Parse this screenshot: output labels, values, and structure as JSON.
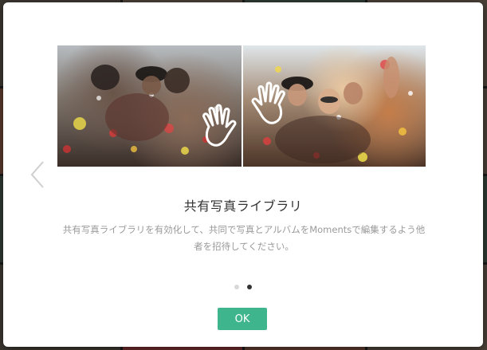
{
  "dialog": {
    "title": "共有写真ライブラリ",
    "description": "共有写真ライブラリを有効化して、共同で写真とアルバムをMomentsで編集するよう他者を招待してください。",
    "ok_label": "OK"
  },
  "pagination": {
    "total": 2,
    "active_index": 1
  },
  "icons": {
    "prev": "chevron-left-icon",
    "hand_left": "waving-hand-icon",
    "hand_right": "waving-hand-icon"
  },
  "colors": {
    "accent": "#3fb58e",
    "title": "#333333",
    "description": "#9a9a9a",
    "dot_inactive": "#d9d9d9",
    "dot_active": "#333333"
  }
}
